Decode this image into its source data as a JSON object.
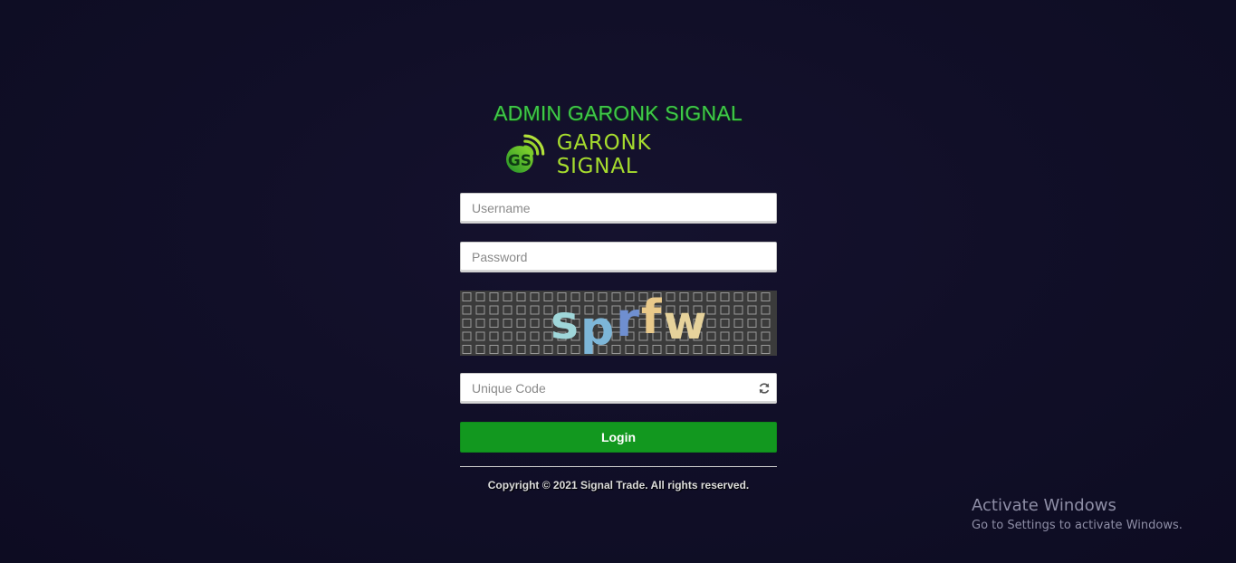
{
  "header": {
    "admin_title": "ADMIN GARONK SIGNAL",
    "brand_name": "GARONK SIGNAL",
    "logo_icon": "garonk-signal-logo-icon",
    "title_color": "#3fc84a",
    "brand_color": "#a6dc2e"
  },
  "login_form": {
    "username_placeholder": "Username",
    "password_placeholder": "Password",
    "captcha_text": "sprfw",
    "captcha_colors": [
      "#9fd6d9",
      "#7db6d8",
      "#6f8fd0",
      "#e9c98a",
      "#e6d29b"
    ],
    "unique_code_placeholder": "Unique Code",
    "refresh_icon": "refresh-icon",
    "login_label": "Login",
    "login_color": "#12981f"
  },
  "footer": {
    "copyright": "Copyright © 2021 Signal Trade. All rights reserved."
  },
  "os_watermark": {
    "title": "Activate Windows",
    "subtitle": "Go to Settings to activate Windows."
  }
}
